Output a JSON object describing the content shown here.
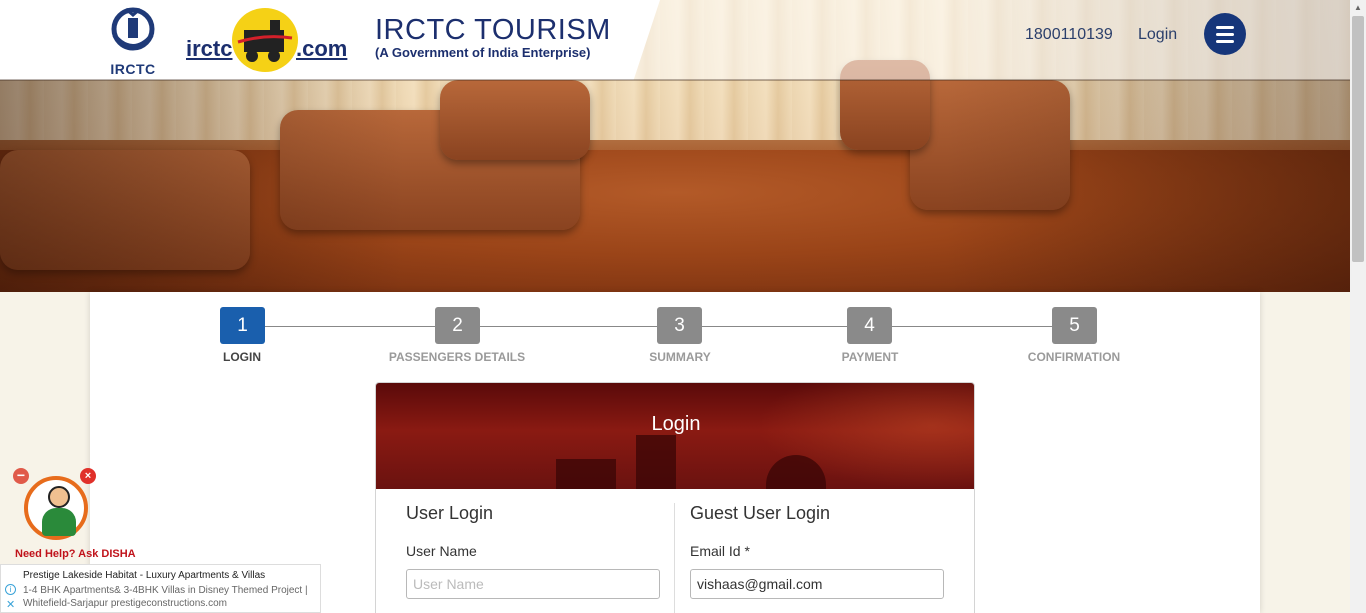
{
  "header": {
    "irctc_logo_text": "IRCTC",
    "tourism_logo_left": "irctc",
    "tourism_logo_right": ".com",
    "brand_title": "IRCTC TOURISM",
    "brand_subtitle": "(A Government of India Enterprise)",
    "phone": "1800110139",
    "login_label": "Login",
    "menu_icon": "hamburger-menu-icon"
  },
  "steps": [
    {
      "number": "1",
      "label": "LOGIN",
      "active": true
    },
    {
      "number": "2",
      "label": "PASSENGERS DETAILS",
      "active": false
    },
    {
      "number": "3",
      "label": "SUMMARY",
      "active": false
    },
    {
      "number": "4",
      "label": "PAYMENT",
      "active": false
    },
    {
      "number": "5",
      "label": "CONFIRMATION",
      "active": false
    }
  ],
  "login": {
    "title": "Login",
    "user_login": {
      "title": "User Login",
      "username_label": "User Name",
      "username_placeholder": "User Name",
      "username_value": ""
    },
    "guest_login": {
      "title": "Guest User Login",
      "email_label": "Email Id *",
      "email_value": "vishaas@gmail.com"
    }
  },
  "disha": {
    "caption": "Need Help? Ask DISHA",
    "minimize": "−",
    "close": "×"
  },
  "ad": {
    "title": "Prestige Lakeside Habitat - Luxury Apartments & Villas",
    "line1": "1-4 BHK Apartments& 3-4BHK Villas in Disney Themed Project |",
    "line2": "Whitefield-Sarjapur prestigeconstructions.com"
  },
  "colors": {
    "brand_navy": "#1c2f6e",
    "step_active": "#1a5fad",
    "step_inactive": "#8a8a8a",
    "disha_red": "#c0121a"
  }
}
